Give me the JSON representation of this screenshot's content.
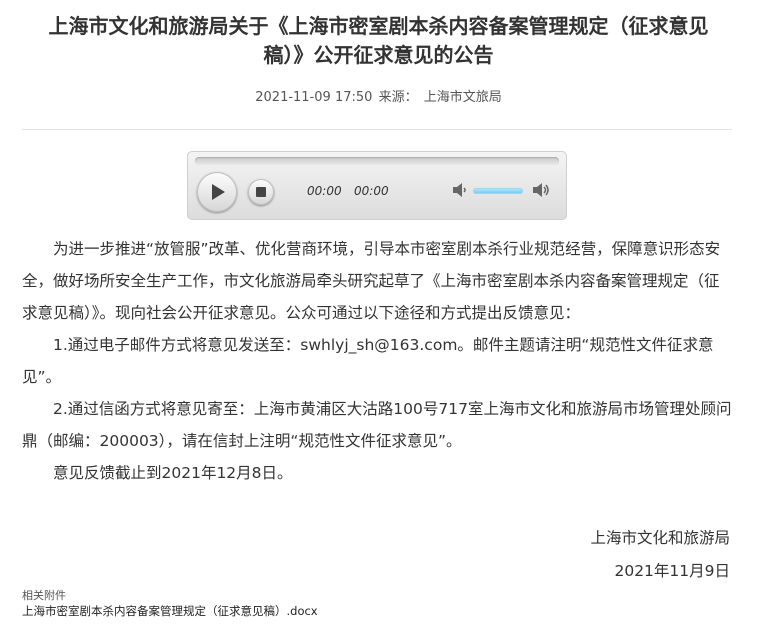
{
  "article": {
    "title": "上海市文化和旅游局关于《上海市密室剧本杀内容备案管理规定（征求意见稿）》公开征求意见的公告",
    "datetime": "2021-11-09 17:50",
    "source_label": "来源：",
    "source": "上海市文旅局"
  },
  "player": {
    "current_time": "00:00",
    "duration": "00:00",
    "progress": 0,
    "volume": 0.8,
    "icons": [
      "play-icon",
      "stop-icon",
      "volume-low-icon",
      "volume-high-icon"
    ]
  },
  "body": {
    "p1": "为进一步推进“放管服”改革、优化营商环境，引导本市密室剧本杀行业规范经营，保障意识形态安全，做好场所安全生产工作，市文化旅游局牵头研究起草了《上海市密室剧本杀内容备案管理规定（征求意见稿）》。现向社会公开征求意见。公众可通过以下途径和方式提出反馈意见：",
    "p2": "1.通过电子邮件方式将意见发送至：swhlyj_sh@163.com。邮件主题请注明“规范性文件征求意见”。",
    "p3": "2.通过信函方式将意见寄至：上海市黄浦区大沽路100号717室上海市文化和旅游局市场管理处顾问鼎（邮编：200003），请在信封上注明“规范性文件征求意见”。",
    "p4": "意见反馈截止到2021年12月8日。"
  },
  "signature": {
    "org": "上海市文化和旅游局",
    "date": "2021年11月9日"
  },
  "attachments": {
    "label": "相关附件",
    "file": "上海市密室剧本杀内容备案管理规定（征求意见稿）.docx"
  }
}
